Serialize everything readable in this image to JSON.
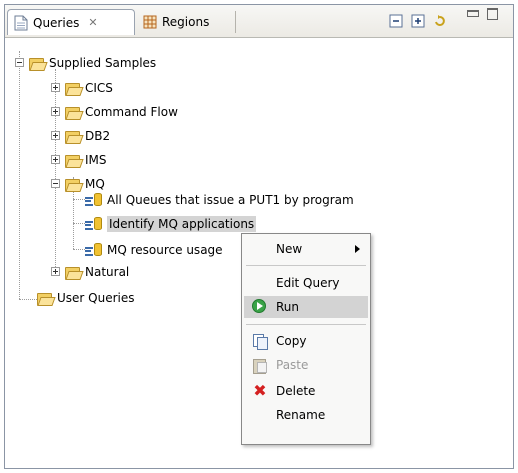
{
  "tabs": [
    {
      "label": "Queries",
      "close": "✕"
    },
    {
      "label": "Regions"
    }
  ],
  "tree": {
    "root": "Supplied Samples",
    "folders": [
      "CICS",
      "Command Flow",
      "DB2",
      "IMS",
      "MQ",
      "Natural"
    ],
    "mq_queries": [
      "All Queues that issue a PUT1 by program",
      "Identify MQ applications",
      "MQ resource usage"
    ],
    "user_root": "User Queries"
  },
  "context_menu": {
    "items": [
      {
        "label": "New",
        "submenu": true
      },
      {
        "label": "Edit Query"
      },
      {
        "label": "Run",
        "highlighted": true
      },
      {
        "label": "Copy"
      },
      {
        "label": "Paste",
        "disabled": true
      },
      {
        "label": "Delete"
      },
      {
        "label": "Rename"
      }
    ]
  },
  "icons": {
    "tab_queries": "document-icon",
    "tab_regions": "grid-icon",
    "folder": "folder-icon",
    "query": "query-icon",
    "run": "run-icon",
    "copy": "copy-icon",
    "paste": "paste-icon",
    "delete": "delete-icon"
  },
  "colors": {
    "folder": "#f2cf63",
    "selection": "#d4d4d4",
    "menu_highlight": "#d3d3d3",
    "run_green": "#3aa348",
    "delete_red": "#d42020"
  }
}
